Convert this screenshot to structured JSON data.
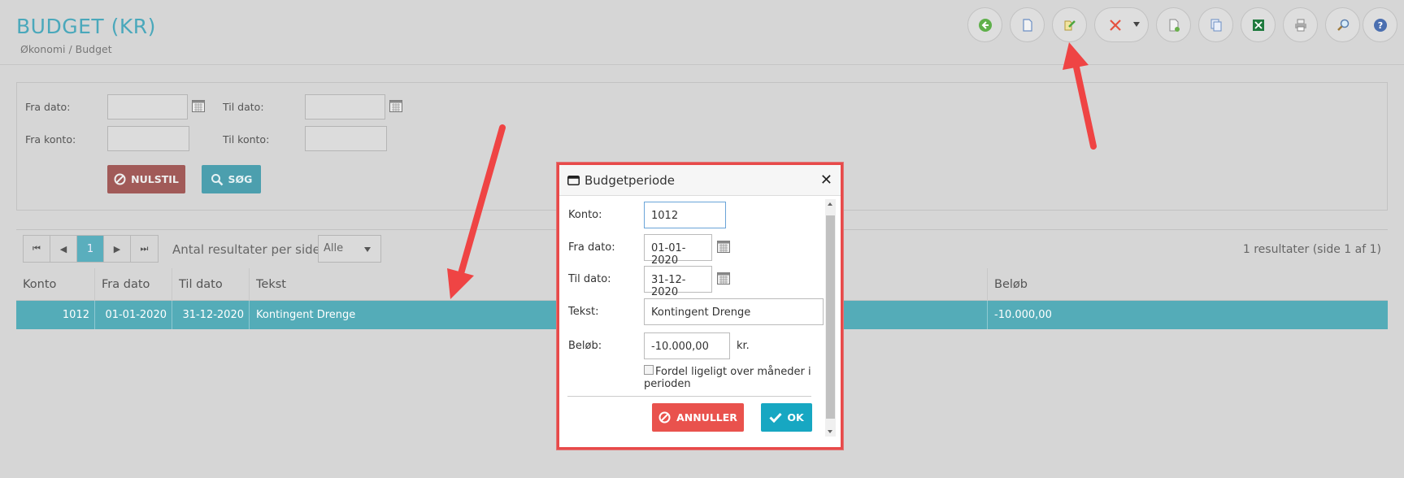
{
  "page": {
    "title": "BUDGET (KR)",
    "breadcrumb": "Økonomi / Budget"
  },
  "toolbar": {
    "buttons": [
      {
        "name": "back",
        "icon": "back-arrow-icon"
      },
      {
        "name": "new",
        "icon": "new-document-icon"
      },
      {
        "name": "edit",
        "icon": "edit-document-icon"
      },
      {
        "name": "delete",
        "icon": "delete-x-icon"
      },
      {
        "name": "export-doc",
        "icon": "export-document-icon"
      },
      {
        "name": "copy",
        "icon": "copy-icon"
      },
      {
        "name": "excel",
        "icon": "excel-icon"
      },
      {
        "name": "print",
        "icon": "print-icon"
      },
      {
        "name": "search",
        "icon": "magnifier-icon"
      },
      {
        "name": "help",
        "icon": "help-icon"
      }
    ]
  },
  "filter": {
    "from_date_label": "Fra dato:",
    "to_date_label": "Til dato:",
    "from_account_label": "Fra konto:",
    "to_account_label": "Til konto:",
    "from_date_value": "",
    "to_date_value": "",
    "from_account_value": "",
    "to_account_value": "",
    "reset_label": "NULSTIL",
    "search_label": "SØG"
  },
  "results": {
    "current_page": "1",
    "per_page_label": "Antal resultater per side",
    "per_page_value": "Alle",
    "count_text": "1 resultater (side 1 af 1)",
    "columns": [
      "Konto",
      "Fra dato",
      "Til dato",
      "Tekst",
      "Beløb"
    ],
    "rows": [
      {
        "konto": "1012",
        "fra": "01-01-2020",
        "til": "31-12-2020",
        "tekst": "Kontingent Drenge",
        "belob": "-10.000,00"
      }
    ]
  },
  "modal": {
    "title": "Budgetperiode",
    "konto_label": "Konto:",
    "konto_value": "1012",
    "fra_label": "Fra dato:",
    "fra_value": "01-01-2020",
    "til_label": "Til dato:",
    "til_value": "31-12-2020",
    "tekst_label": "Tekst:",
    "tekst_value": "Kontingent Drenge",
    "belob_label": "Beløb:",
    "belob_value": "-10.000,00",
    "belob_unit": "kr.",
    "distribute_label": "Fordel ligeligt over måneder i perioden",
    "cancel_label": "ANNULLER",
    "ok_label": "OK"
  },
  "colors": {
    "accent": "#54acb8",
    "highlight_border": "#e84a4a",
    "annotation_arrow": "#ef4444"
  }
}
